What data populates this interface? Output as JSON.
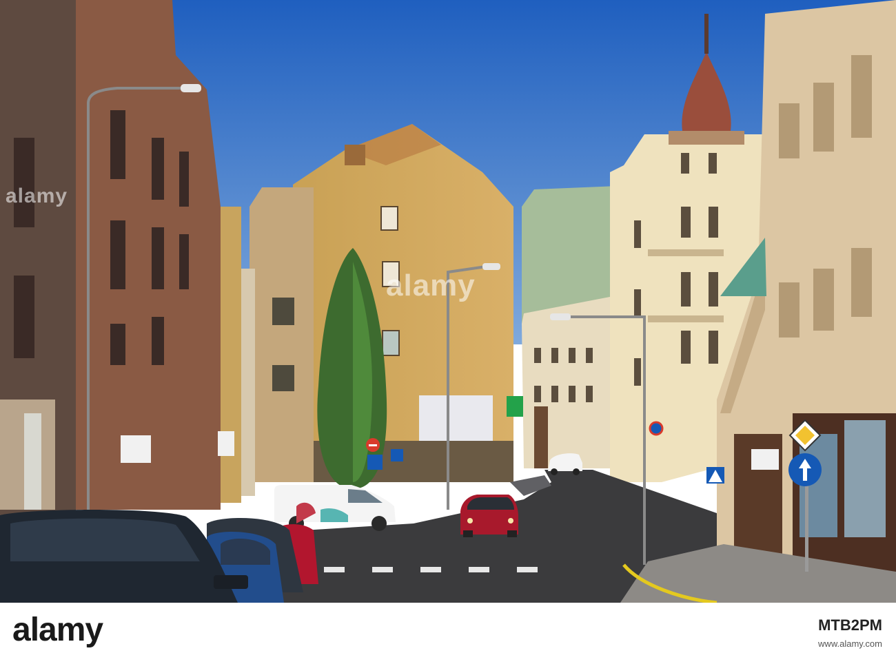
{
  "watermark": {
    "text": "alamy"
  },
  "footer": {
    "logo": "alamy",
    "image_id": "MTB2PM",
    "site_url": "www.alamy.com"
  },
  "scene": {
    "sky_color": "#2f6fc4",
    "road_color": "#3b3b3d"
  }
}
